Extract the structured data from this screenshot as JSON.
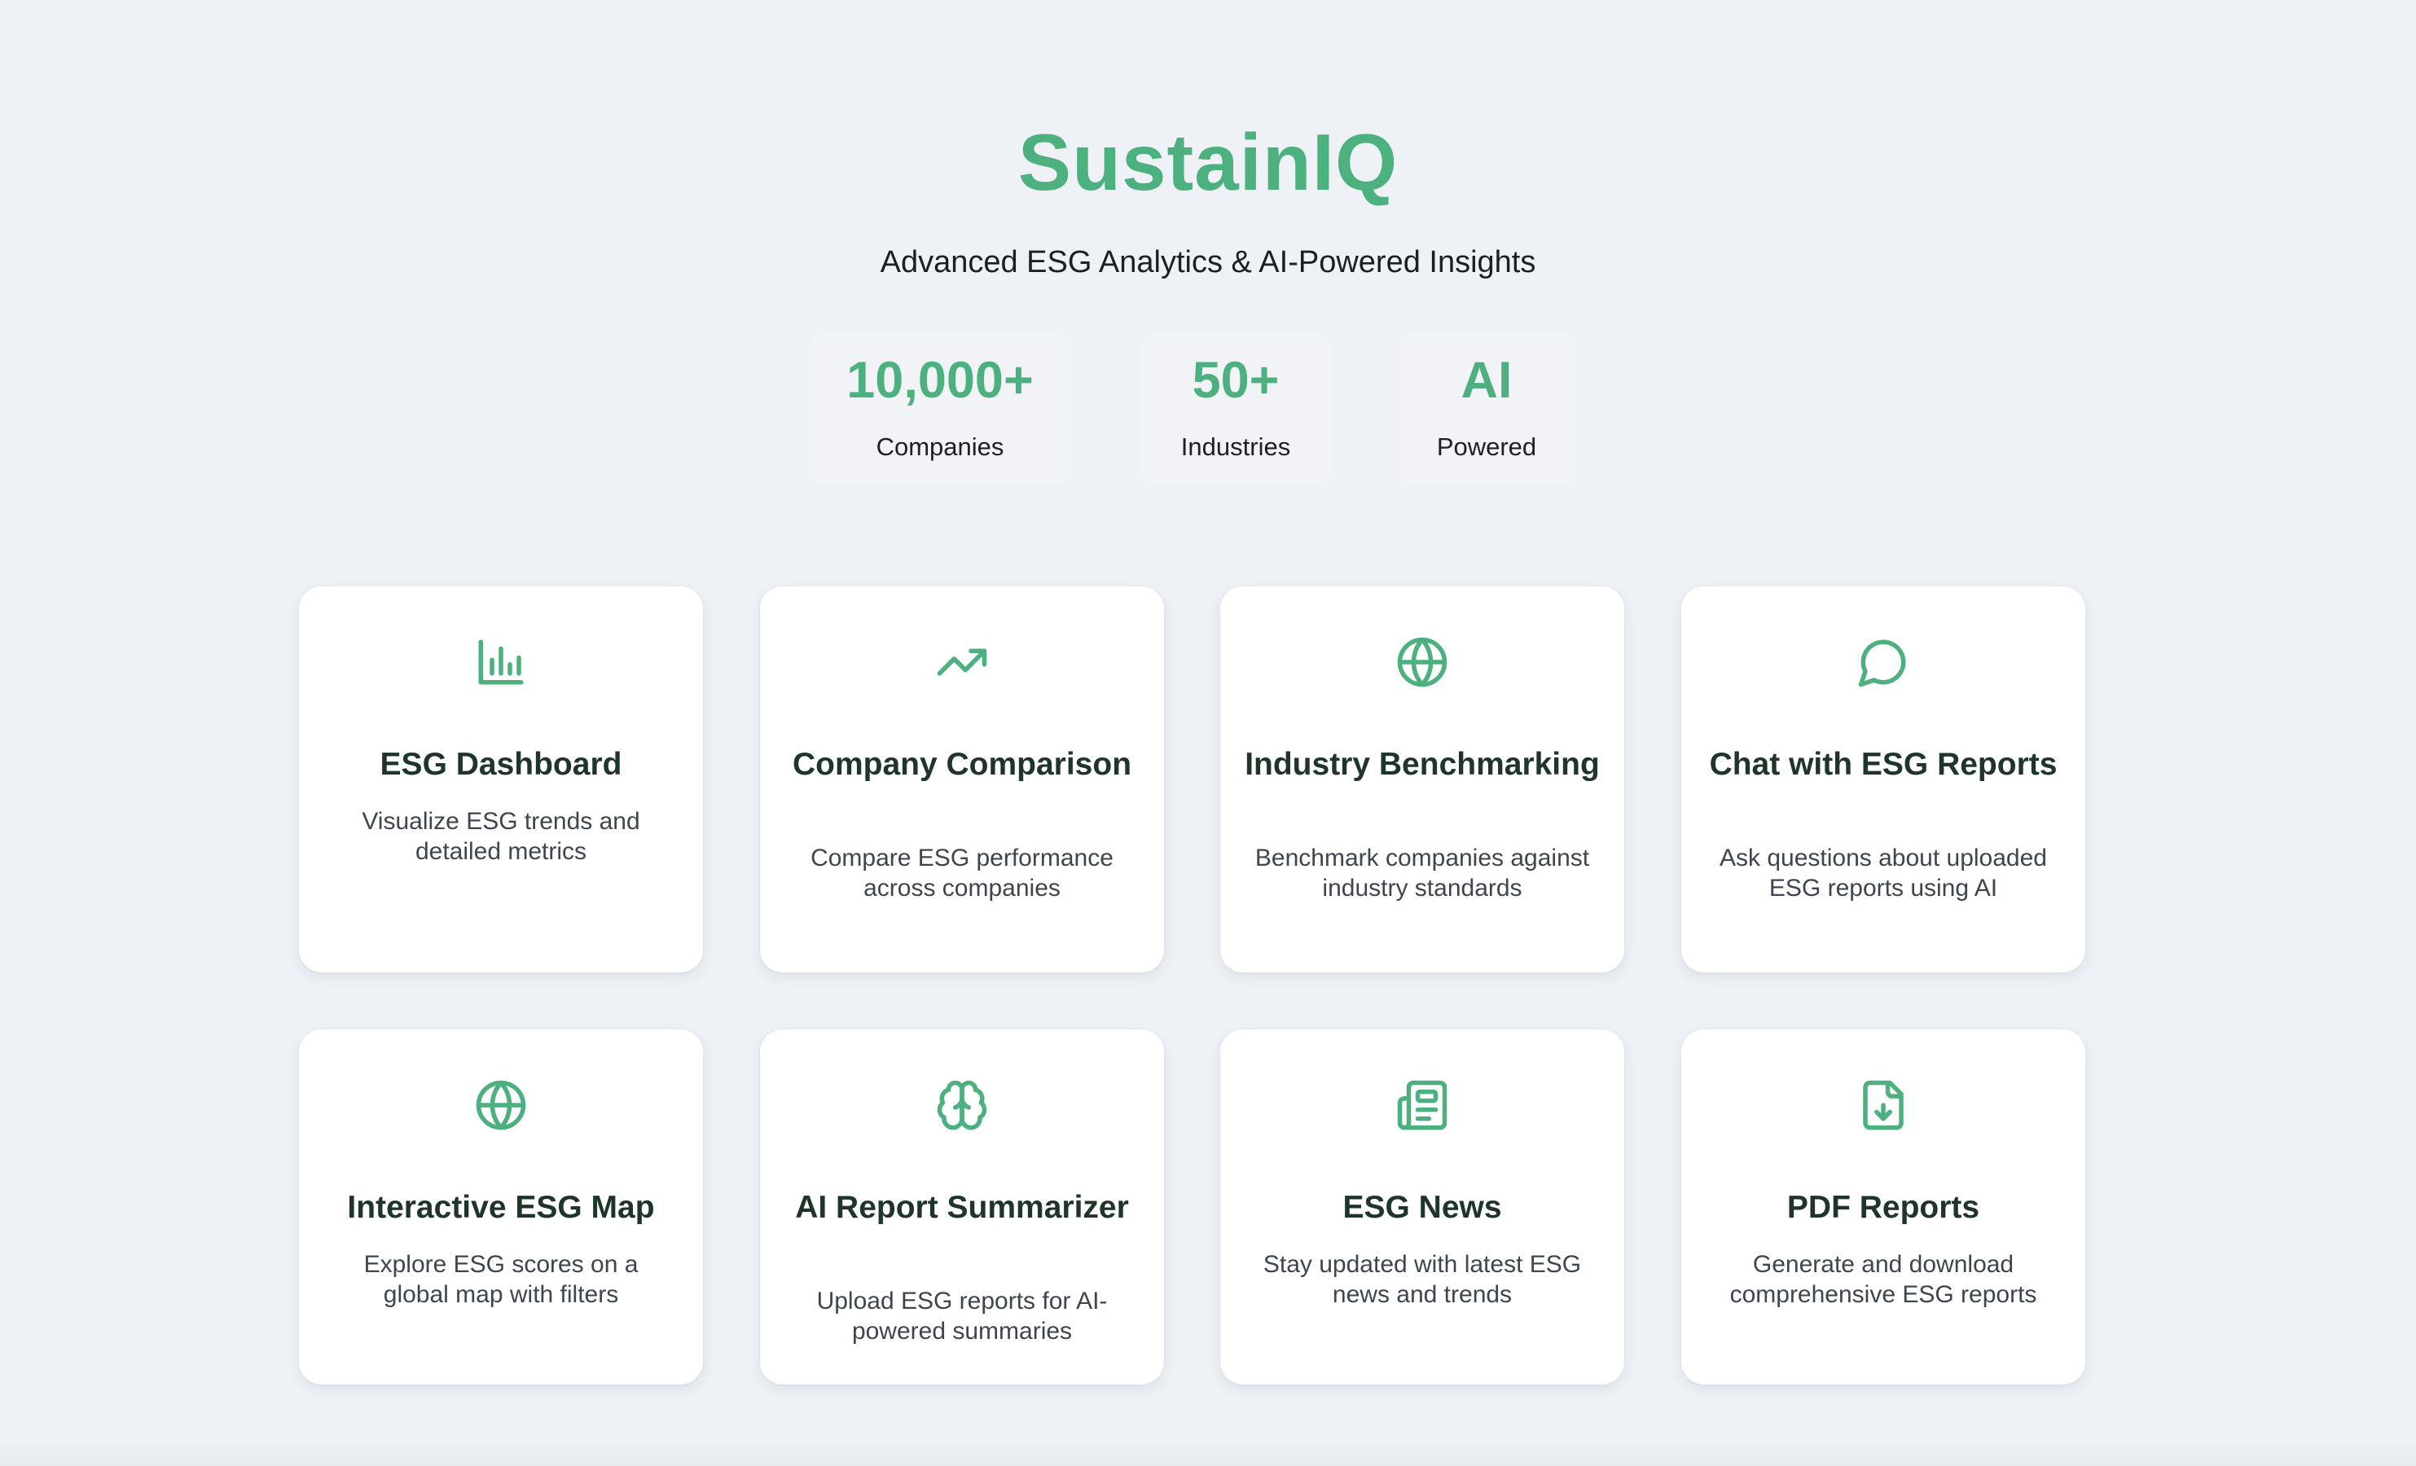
{
  "header": {
    "brand": "SustainIQ",
    "tagline": "Advanced ESG Analytics & AI-Powered Insights"
  },
  "stats": [
    {
      "value": "10,000+",
      "label": "Companies"
    },
    {
      "value": "50+",
      "label": "Industries"
    },
    {
      "value": "AI",
      "label": "Powered"
    }
  ],
  "features": [
    {
      "icon": "bar-chart-icon",
      "title": "ESG Dashboard",
      "description": "Visualize ESG trends and detailed metrics"
    },
    {
      "icon": "trending-up-icon",
      "title": "Company Comparison",
      "description": "Compare ESG performance across companies"
    },
    {
      "icon": "globe-icon",
      "title": "Industry Benchmarking",
      "description": "Benchmark companies against industry standards"
    },
    {
      "icon": "chat-bubble-icon",
      "title": "Chat with ESG Reports",
      "description": "Ask questions about uploaded ESG reports using AI"
    },
    {
      "icon": "globe-icon",
      "title": "Interactive ESG Map",
      "description": "Explore ESG scores on a global map with filters"
    },
    {
      "icon": "brain-icon",
      "title": "AI Report Summarizer",
      "description": "Upload ESG reports for AI-powered summaries"
    },
    {
      "icon": "newspaper-icon",
      "title": "ESG News",
      "description": "Stay updated with latest ESG news and trends"
    },
    {
      "icon": "file-download-icon",
      "title": "PDF Reports",
      "description": "Generate and download comprehensive ESG reports"
    }
  ],
  "colors": {
    "accent": "#4cb07f",
    "background": "#eef1f6",
    "card": "#ffffff",
    "title_text": "#1f3529"
  }
}
